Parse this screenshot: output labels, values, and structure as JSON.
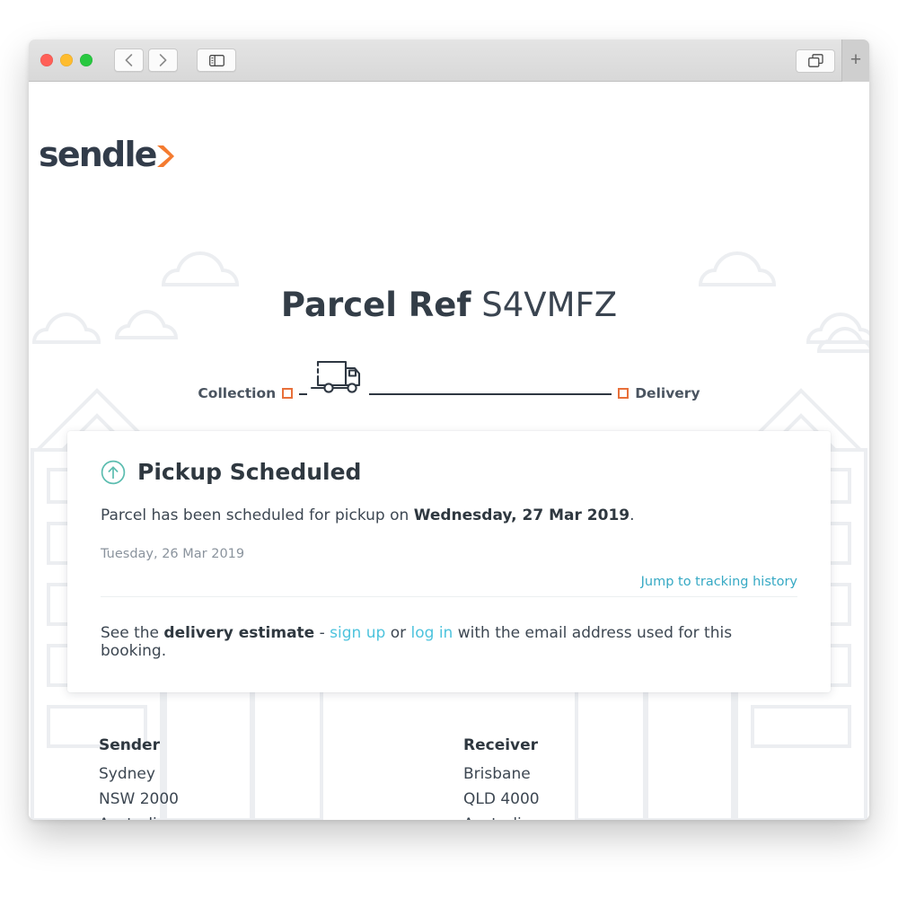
{
  "window": {
    "traffic_lights": [
      "close",
      "minimize",
      "zoom"
    ],
    "nav_back_label": "Back",
    "nav_forward_label": "Forward",
    "sidebar_label": "Show Sidebar",
    "tab_overview_label": "Tab Overview",
    "new_tab_label": "+"
  },
  "brand": {
    "wordmark": "sendle",
    "accent_orange": "#f47b30",
    "wordmark_color": "#323c4a"
  },
  "header": {
    "title_bold": "Parcel Ref",
    "title_ref": "S4VMFZ"
  },
  "tracker": {
    "collection_label": "Collection",
    "delivery_label": "Delivery",
    "marker_color": "#e8703a",
    "rail_color": "#2e3742",
    "vehicle_icon": "truck-icon"
  },
  "status_card": {
    "icon": "pickup-arrow-icon",
    "icon_color": "#5cbdb0",
    "title": "Pickup Scheduled",
    "body_prefix": "Parcel has been scheduled for pickup on ",
    "body_date": "Wednesday, 27 Mar 2019",
    "body_suffix": ".",
    "event_date": "Tuesday, 26 Mar 2019",
    "jump_link": "Jump to tracking history",
    "jump_link_color": "#36a9c4",
    "footer_prefix": "See the ",
    "footer_bold": "delivery estimate",
    "footer_dash": " - ",
    "footer_signup": "sign up",
    "footer_or": " or ",
    "footer_login": "log in",
    "footer_suffix": " with the email address used for this booking.",
    "footer_link_color": "#4dc3dd"
  },
  "addresses": {
    "sender": {
      "heading": "Sender",
      "lines": [
        "Sydney",
        "NSW 2000",
        "Australia"
      ]
    },
    "receiver": {
      "heading": "Receiver",
      "lines": [
        "Brisbane",
        "QLD 4000",
        "Australia"
      ]
    }
  }
}
